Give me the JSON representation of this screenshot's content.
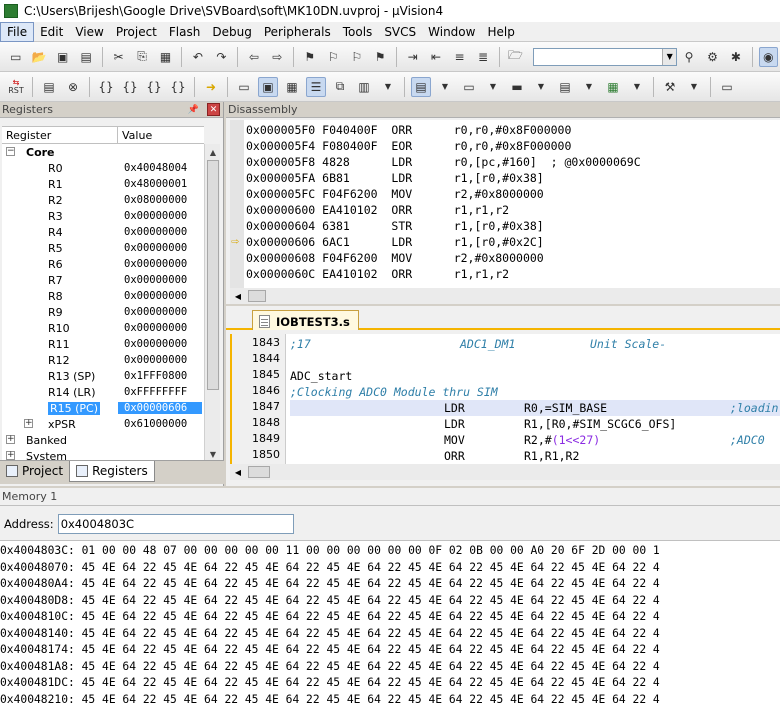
{
  "window": {
    "title": "C:\\Users\\Brijesh\\Google Drive\\SVBoard\\soft\\MK10DN.uvproj - µVision4"
  },
  "menu": [
    "File",
    "Edit",
    "View",
    "Project",
    "Flash",
    "Debug",
    "Peripherals",
    "Tools",
    "SVCS",
    "Window",
    "Help"
  ],
  "toolbar2": {
    "rst_label": "RST"
  },
  "registers": {
    "title": "Registers",
    "col_register": "Register",
    "col_value": "Value",
    "group_core": "Core",
    "rows": [
      {
        "name": "R0",
        "value": "0x40048004"
      },
      {
        "name": "R1",
        "value": "0x48000001"
      },
      {
        "name": "R2",
        "value": "0x08000000"
      },
      {
        "name": "R3",
        "value": "0x00000000"
      },
      {
        "name": "R4",
        "value": "0x00000000"
      },
      {
        "name": "R5",
        "value": "0x00000000"
      },
      {
        "name": "R6",
        "value": "0x00000000"
      },
      {
        "name": "R7",
        "value": "0x00000000"
      },
      {
        "name": "R8",
        "value": "0x00000000"
      },
      {
        "name": "R9",
        "value": "0x00000000"
      },
      {
        "name": "R10",
        "value": "0x00000000"
      },
      {
        "name": "R11",
        "value": "0x00000000"
      },
      {
        "name": "R12",
        "value": "0x00000000"
      },
      {
        "name": "R13 (SP)",
        "value": "0x1FFF0800"
      },
      {
        "name": "R14 (LR)",
        "value": "0xFFFFFFFF"
      },
      {
        "name": "R15 (PC)",
        "value": "0x00000606"
      },
      {
        "name": "xPSR",
        "value": "0x61000000"
      }
    ],
    "group_banked": "Banked",
    "group_system": "System"
  },
  "panel_tabs": {
    "project": "Project",
    "registers": "Registers"
  },
  "disassembly": {
    "title": "Disassembly",
    "current_index": 7,
    "lines": [
      "0x000005F0 F040400F  ORR      r0,r0,#0x8F000000",
      "0x000005F4 F080400F  EOR      r0,r0,#0x8F000000",
      "0x000005F8 4828      LDR      r0,[pc,#160]  ; @0x0000069C",
      "0x000005FA 6B81      LDR      r1,[r0,#0x38]",
      "0x000005FC F04F6200  MOV      r2,#0x8000000",
      "0x00000600 EA410102  ORR      r1,r1,r2",
      "0x00000604 6381      STR      r1,[r0,#0x38]",
      "0x00000606 6AC1      LDR      r1,[r0,#0x2C]",
      "0x00000608 F04F6200  MOV      r2,#0x8000000",
      "0x0000060C EA410102  ORR      r1,r1,r2"
    ]
  },
  "source": {
    "tab_name": "IOBTEST3.s",
    "lines": [
      {
        "num": "1843",
        "label": ";17",
        "op": "ADC1_DM1",
        "args": "Unit Scale-",
        "comment": ""
      },
      {
        "num": "1844",
        "label": "",
        "op": "",
        "args": "",
        "comment": ""
      },
      {
        "num": "1845",
        "label": "ADC_start",
        "op": "",
        "args": "",
        "comment": ""
      },
      {
        "num": "1846",
        "label": ";Clocking ADC0 Module thru SIM",
        "op": "",
        "args": "",
        "comment": ""
      },
      {
        "num": "1847",
        "label": "",
        "op": "LDR",
        "args": "R0,=SIM_BASE",
        "comment": ";loadin"
      },
      {
        "num": "1848",
        "label": "",
        "op": "LDR",
        "args": "R1,[R0,#SIM_SCGC6_OFS]",
        "comment": ""
      },
      {
        "num": "1849",
        "label": "",
        "op": "MOV",
        "args_pre": "R2,#",
        "args_num": "(1<<27)",
        "comment": ";ADC0"
      },
      {
        "num": "1850",
        "label": "",
        "op": "ORR",
        "args": "R1,R1,R2",
        "comment": ""
      }
    ]
  },
  "memory": {
    "title": "Memory 1",
    "address_label": "Address:",
    "address_value": "0x4004803C",
    "rows": [
      "0x4004803C: 01 00 00 48 07 00 00 00 00 00 11 00 00 00 00 00 00 0F 02 0B 00 00 A0 20 6F 2D 00 00 1",
      "0x40048070: 45 4E 64 22 45 4E 64 22 45 4E 64 22 45 4E 64 22 45 4E 64 22 45 4E 64 22 45 4E 64 22 4",
      "0x400480A4: 45 4E 64 22 45 4E 64 22 45 4E 64 22 45 4E 64 22 45 4E 64 22 45 4E 64 22 45 4E 64 22 4",
      "0x400480D8: 45 4E 64 22 45 4E 64 22 45 4E 64 22 45 4E 64 22 45 4E 64 22 45 4E 64 22 45 4E 64 22 4",
      "0x4004810C: 45 4E 64 22 45 4E 64 22 45 4E 64 22 45 4E 64 22 45 4E 64 22 45 4E 64 22 45 4E 64 22 4",
      "0x40048140: 45 4E 64 22 45 4E 64 22 45 4E 64 22 45 4E 64 22 45 4E 64 22 45 4E 64 22 45 4E 64 22 4",
      "0x40048174: 45 4E 64 22 45 4E 64 22 45 4E 64 22 45 4E 64 22 45 4E 64 22 45 4E 64 22 45 4E 64 22 4",
      "0x400481A8: 45 4E 64 22 45 4E 64 22 45 4E 64 22 45 4E 64 22 45 4E 64 22 45 4E 64 22 45 4E 64 22 4",
      "0x400481DC: 45 4E 64 22 45 4E 64 22 45 4E 64 22 45 4E 64 22 45 4E 64 22 45 4E 64 22 45 4E 64 22 4",
      "0x40048210: 45 4E 64 22 45 4E 64 22 45 4E 64 22 45 4E 64 22 45 4E 64 22 45 4E 64 22 45 4E 64 22 4"
    ]
  },
  "colors": {
    "selection": "#3399ff",
    "source_tab_accent": "#f5b400",
    "comment": "#2f7fa8"
  }
}
